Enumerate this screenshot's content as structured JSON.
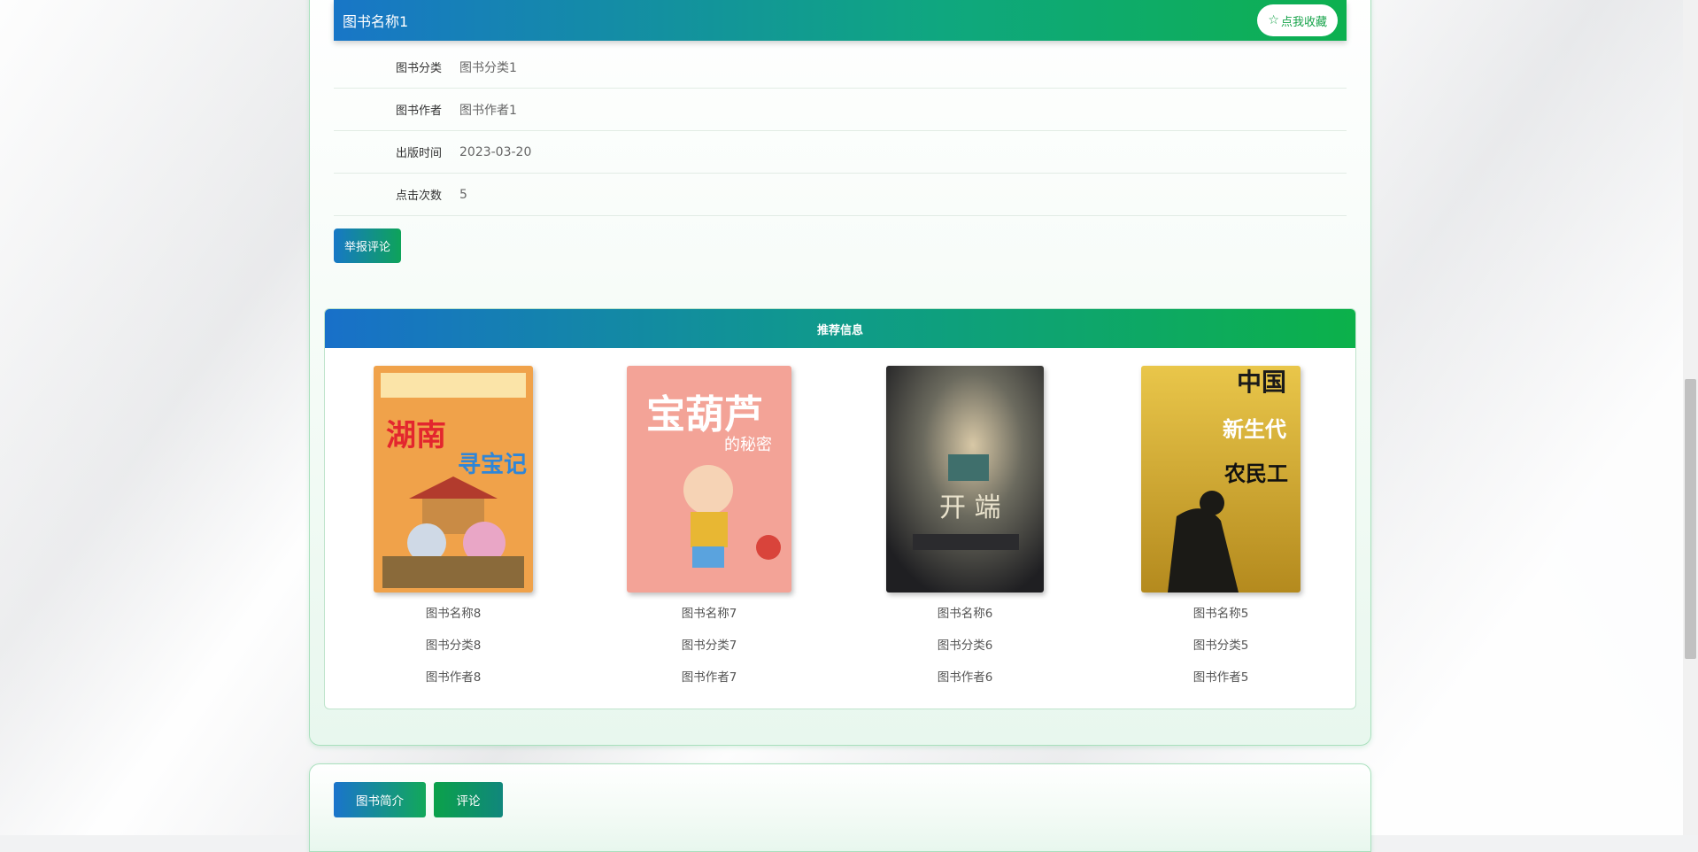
{
  "book": {
    "title": "图书名称1",
    "favorite_label": "点我收藏",
    "favorite_icon": "star-outline-icon",
    "fields": [
      {
        "label": "图书分类",
        "value": "图书分类1"
      },
      {
        "label": "图书作者",
        "value": "图书作者1"
      },
      {
        "label": "出版时间",
        "value": "2023-03-20"
      },
      {
        "label": "点击次数",
        "value": "5"
      }
    ],
    "report_label": "举报评论"
  },
  "recommend": {
    "header": "推荐信息",
    "items": [
      {
        "name": "图书名称8",
        "category": "图书分类8",
        "author": "图书作者8",
        "cover_text": "湖南寻宝记"
      },
      {
        "name": "图书名称7",
        "category": "图书分类7",
        "author": "图书作者7",
        "cover_text": "宝葫芦的秘密"
      },
      {
        "name": "图书名称6",
        "category": "图书分类6",
        "author": "图书作者6",
        "cover_text": "开端"
      },
      {
        "name": "图书名称5",
        "category": "图书分类5",
        "author": "图书作者5",
        "cover_text": "中国新生代农民工"
      }
    ]
  },
  "tabs": [
    {
      "label": "图书简介"
    },
    {
      "label": "评论"
    }
  ],
  "colors": {
    "accent_blue": "#1876c7",
    "accent_green": "#0db04f"
  }
}
